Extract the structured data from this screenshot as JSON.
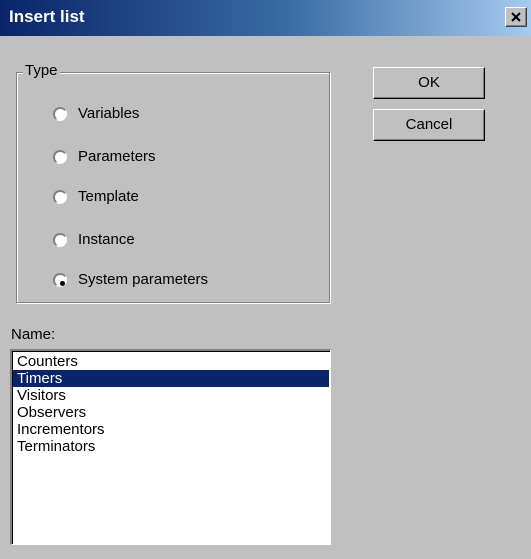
{
  "window": {
    "title": "Insert list"
  },
  "type_group": {
    "legend": "Type",
    "options": [
      {
        "label": "Variables",
        "checked": false
      },
      {
        "label": "Parameters",
        "checked": false
      },
      {
        "label": "Template",
        "checked": false
      },
      {
        "label": "Instance",
        "checked": false
      },
      {
        "label": "System parameters",
        "checked": true
      }
    ]
  },
  "buttons": {
    "ok_label": "OK",
    "cancel_label": "Cancel"
  },
  "name_list": {
    "label": "Name:",
    "items": [
      "Counters",
      "Timers",
      "Visitors",
      "Observers",
      "Incrementors",
      "Terminators"
    ],
    "selected_item": "Timers"
  },
  "colors": {
    "title_bar_start": "#0a246a",
    "title_bar_end": "#a6caf0",
    "selection": "#0a246a",
    "face": "#c0c0c0"
  },
  "icons": {
    "close": "close-icon"
  }
}
